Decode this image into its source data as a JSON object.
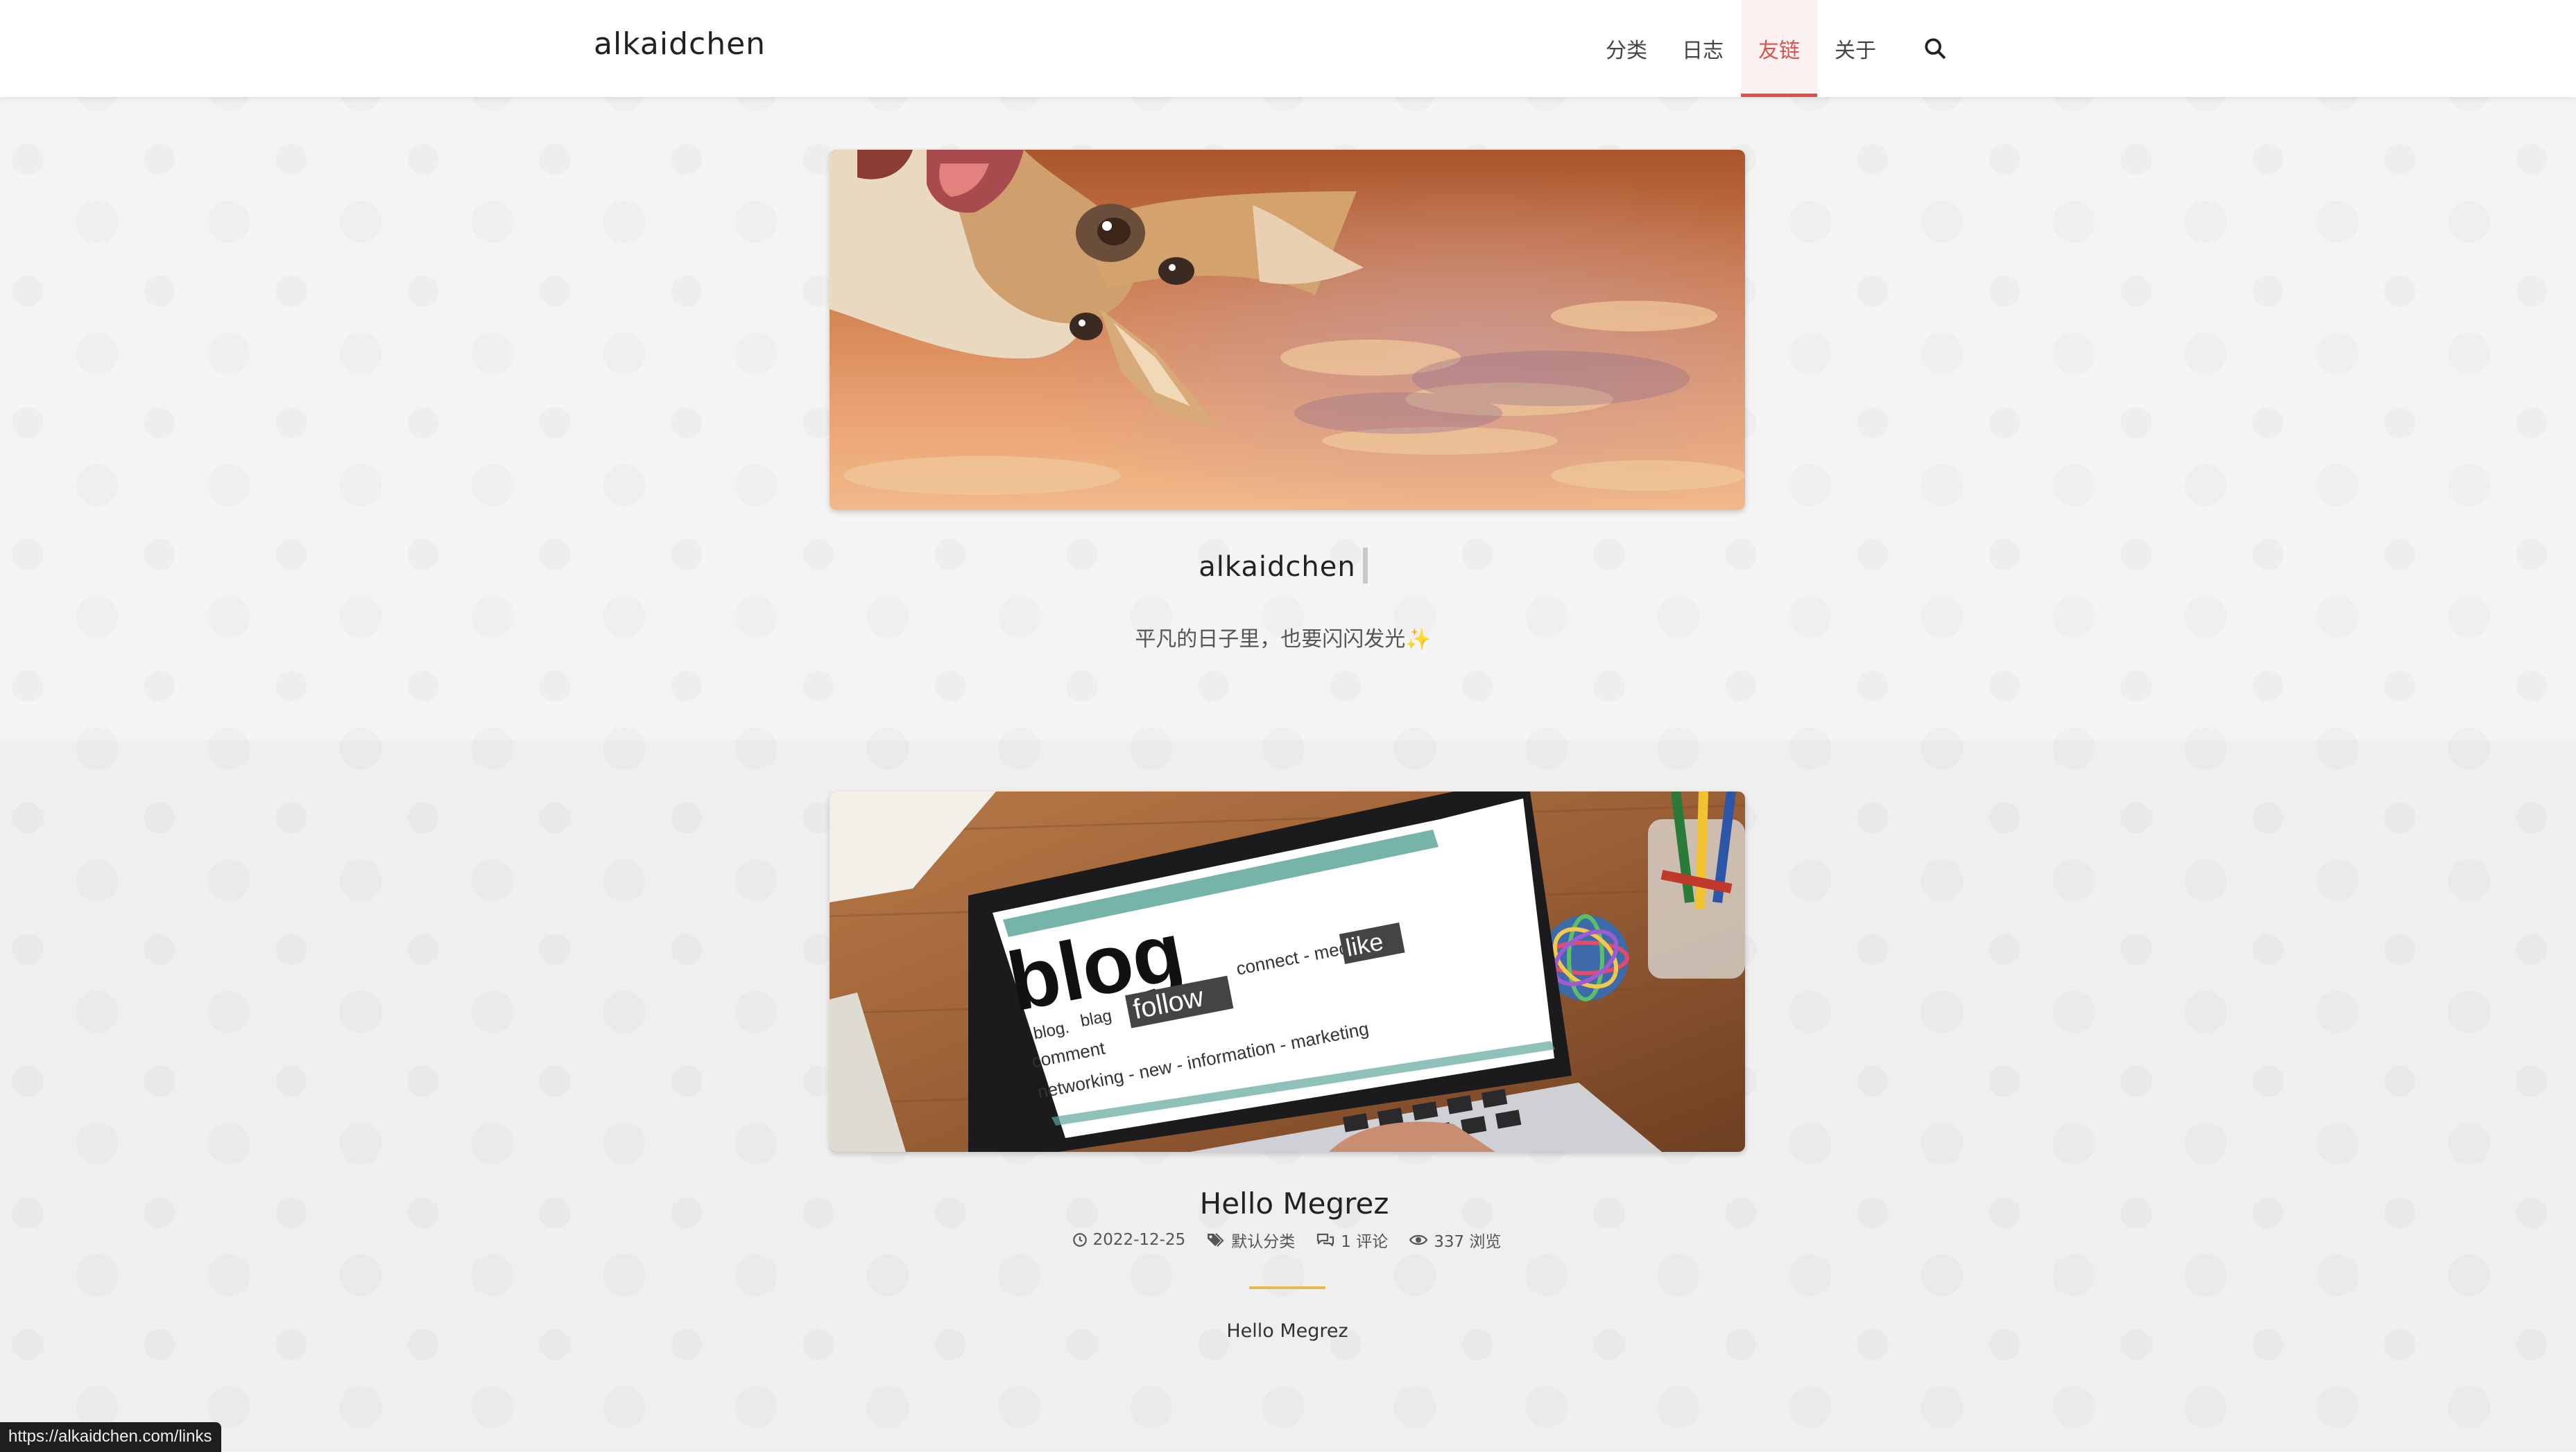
{
  "site": {
    "brand": "alkaidchen"
  },
  "nav": {
    "items": [
      {
        "label": "分类",
        "active": false
      },
      {
        "label": "日志",
        "active": false
      },
      {
        "label": "友链",
        "active": true
      },
      {
        "label": "关于",
        "active": false
      }
    ],
    "search_icon": "search-icon"
  },
  "hero": {
    "title": "alkaidchen",
    "subtitle": "平凡的日子里，也要闪闪发光✨"
  },
  "post": {
    "title": "Hello Megrez",
    "date": "2022-12-25",
    "category": "默认分类",
    "comments": "1 评论",
    "views": "337 浏览",
    "excerpt": "Hello Megrez",
    "image_words": {
      "word1": "blog",
      "word2": "follow",
      "word3": "like",
      "word4": "comment",
      "word5": "networking - new - information - marketing",
      "word6": "connect - media",
      "word7": "blog.",
      "word8": "blag"
    }
  },
  "status_bar": {
    "url": "https://alkaidchen.com/links"
  },
  "colors": {
    "accent": "#e0504a",
    "divider": "#e8b84a",
    "background": "#f4f4f4"
  }
}
